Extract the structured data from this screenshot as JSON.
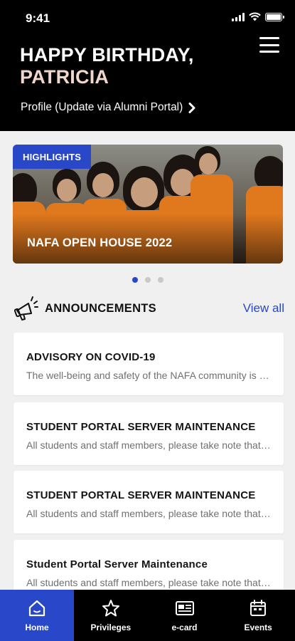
{
  "status_bar": {
    "time": "9:41"
  },
  "header": {
    "greeting_line1": "HAPPY BIRTHDAY,",
    "greeting_name": "PATRICIA",
    "profile_link": "Profile (Update via Alumni Portal)"
  },
  "carousel": {
    "badge": "HIGHLIGHTS",
    "title": "NAFA OPEN HOUSE 2022",
    "page_count": 3,
    "active_page": 1
  },
  "announcements": {
    "title": "ANNOUNCEMENTS",
    "view_all": "View all",
    "items": [
      {
        "title": "ADVISORY ON COVID-19",
        "body": "The well-being and safety of the NAFA community is our top priority"
      },
      {
        "title": "STUDENT PORTAL SERVER MAINTENANCE",
        "body": "All students and staff members, please take note that the portal will be unavailable"
      },
      {
        "title": "STUDENT PORTAL SERVER MAINTENANCE",
        "body": "All students and staff members, please take note that the portal will be unavailable"
      },
      {
        "title": "Student Portal Server Maintenance",
        "body": "All students and staff members, please take note that the portal will be unavailable"
      }
    ]
  },
  "tabs": [
    {
      "label": "Home",
      "icon": "home-icon",
      "active": true
    },
    {
      "label": "Privileges",
      "icon": "star-icon",
      "active": false
    },
    {
      "label": "e-card",
      "icon": "id-card-icon",
      "active": false
    },
    {
      "label": "Events",
      "icon": "calendar-icon",
      "active": false
    }
  ],
  "colors": {
    "accent": "#2947c9",
    "header_bg": "#000000",
    "name_tint": "#f1d6cc"
  }
}
